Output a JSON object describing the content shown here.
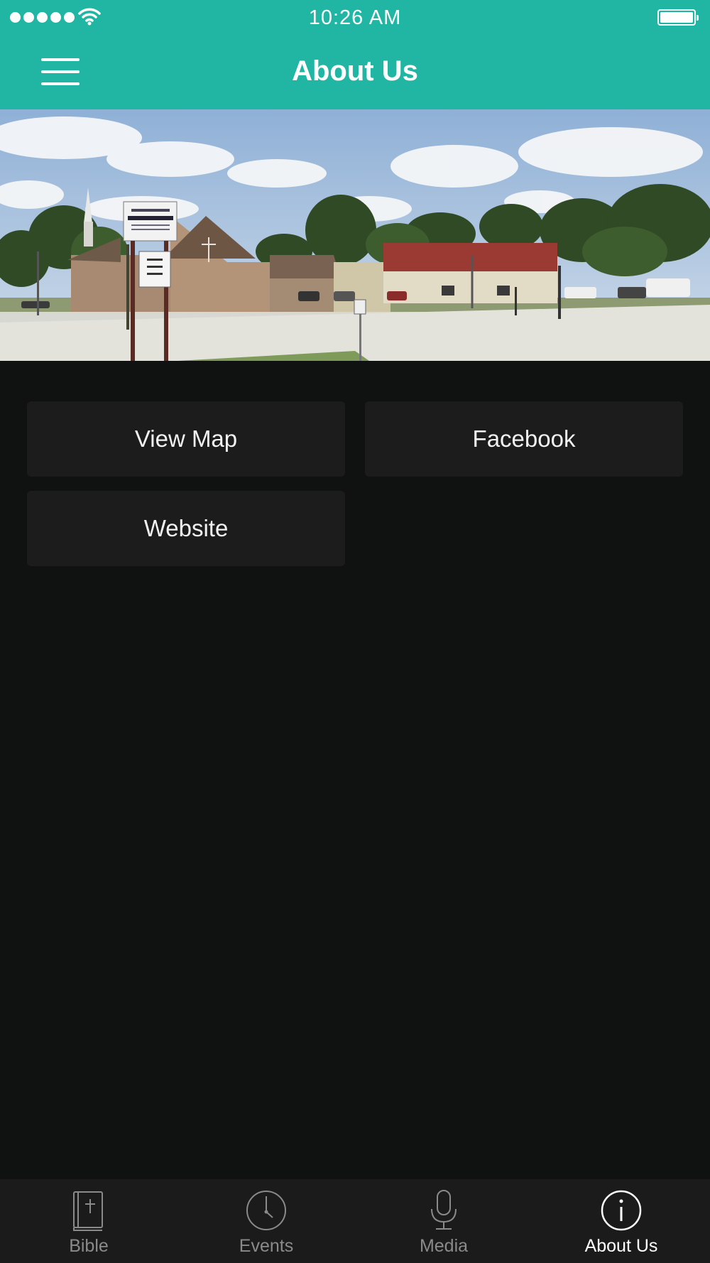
{
  "status_bar": {
    "time": "10:26 AM",
    "signal_icon": "signal-dots-icon",
    "wifi_icon": "wifi-icon",
    "battery_icon": "battery-icon"
  },
  "nav": {
    "title": "About Us",
    "menu_icon": "hamburger-menu-icon"
  },
  "hero": {
    "description_icon": "church-building-photo"
  },
  "buttons": {
    "view_map": "View Map",
    "facebook": "Facebook",
    "website": "Website"
  },
  "tabs": [
    {
      "label": "Bible",
      "icon": "bible-icon",
      "active": false
    },
    {
      "label": "Events",
      "icon": "clock-icon",
      "active": false
    },
    {
      "label": "Media",
      "icon": "microphone-icon",
      "active": false
    },
    {
      "label": "About Us",
      "icon": "info-icon",
      "active": true
    }
  ],
  "colors": {
    "accent": "#21b6a4",
    "background": "#101111",
    "button_bg": "#1c1c1c",
    "tabbar_bg": "#1b1b1b"
  }
}
